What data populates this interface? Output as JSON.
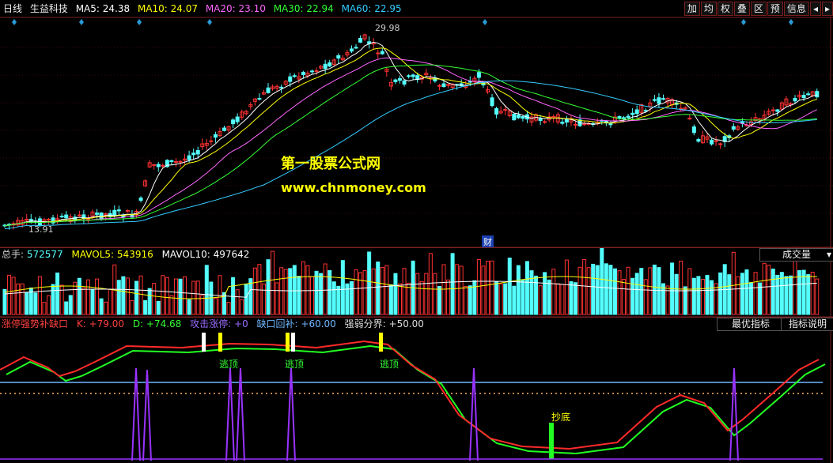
{
  "header": {
    "period": "日线",
    "stock": "生益科技",
    "ma": [
      {
        "label": "MA5: 24.38",
        "color": "#ffffff"
      },
      {
        "label": "MA10: 24.07",
        "color": "#ffff00"
      },
      {
        "label": "MA20: 23.10",
        "color": "#ff66ff"
      },
      {
        "label": "MA30: 22.94",
        "color": "#33ff33"
      },
      {
        "label": "MA60: 22.95",
        "color": "#33ccff"
      }
    ],
    "buttons": [
      "加",
      "均",
      "权",
      "叠",
      "区",
      "预",
      "信息",
      "◂",
      "▸"
    ]
  },
  "price_chart": {
    "high_label": "29.98",
    "low_label": "13.91",
    "finance_marker": "财",
    "watermark_1": "第一股票公式网",
    "watermark_2": "www.chnmoney.com"
  },
  "volume_panel": {
    "total_label": "总手: ",
    "total_value": "572577",
    "mavol5_label": "MAVOL5: 543916",
    "mavol10_label": "MAVOL10: 497642",
    "selector": "成交量",
    "selector_arrow": "▾"
  },
  "indicator_panel": {
    "name": "涨停强势补缺口",
    "k": "K: +79.00",
    "d": "D: +74.68",
    "attack": "攻击涨停: +0",
    "gap_fill": "缺口回补: +60.00",
    "boundary": "强弱分界: +50.00",
    "btn_best": "最优指标",
    "btn_help": "指标说明",
    "escape_label": "逃顶",
    "bottom_label": "抄底"
  },
  "colors": {
    "up": "#ff3232",
    "down": "#54ffff",
    "k": "#ff2a2a",
    "d": "#22ff22",
    "spike": "#9933ff"
  },
  "chart_data": {
    "type": "candlestick",
    "series": [],
    "price_high": 29.98,
    "price_low": 13.91
  }
}
